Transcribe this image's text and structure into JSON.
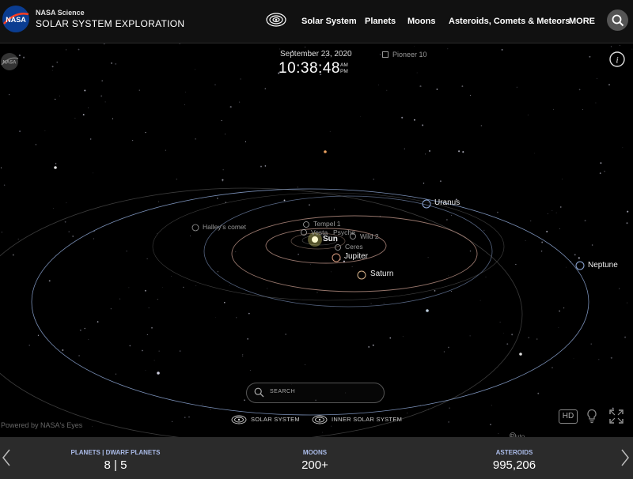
{
  "header": {
    "brand_sub": "NASA Science",
    "brand_main": "SOLAR SYSTEM EXPLORATION",
    "logo_text": "NASA",
    "nav": [
      "Solar System",
      "Planets",
      "Moons",
      "Asteroids, Comets & Meteors",
      "MORE"
    ]
  },
  "hud": {
    "date": "September 23, 2020",
    "time": "10:38:48",
    "am": "AM",
    "pm": "PM",
    "target": "Pioneer 10",
    "info": "i"
  },
  "bodies": {
    "sun": "Sun",
    "jupiter": "Jupiter",
    "saturn": "Saturn",
    "uranus": "Uranus",
    "neptune": "Neptune",
    "halley": "Halley's comet",
    "tempel": "Tempel 1",
    "vesta": "Vesta",
    "psyche": "Psyche",
    "wild2": "Wild 2",
    "ceres": "Ceres",
    "pluto": "Pluto"
  },
  "controls": {
    "search_placeholder": "SEARCH",
    "powered_by": "Powered by NASA's Eyes",
    "solar_system": "SOLAR SYSTEM",
    "inner_solar_system": "INNER SOLAR SYSTEM",
    "hd": "HD"
  },
  "footer": {
    "planets_label": "PLANETS | DWARF PLANETS",
    "planets_value": "8 | 5",
    "moons_label": "MOONS",
    "moons_value": "200+",
    "asteroids_label": "ASTEROIDS",
    "asteroids_value": "995,206"
  },
  "colors": {
    "accent": "#aabbe8",
    "sun": "#f3ee7a",
    "orbit_planet": "#b08a7e",
    "orbit_outer": "#8fa9d8"
  }
}
